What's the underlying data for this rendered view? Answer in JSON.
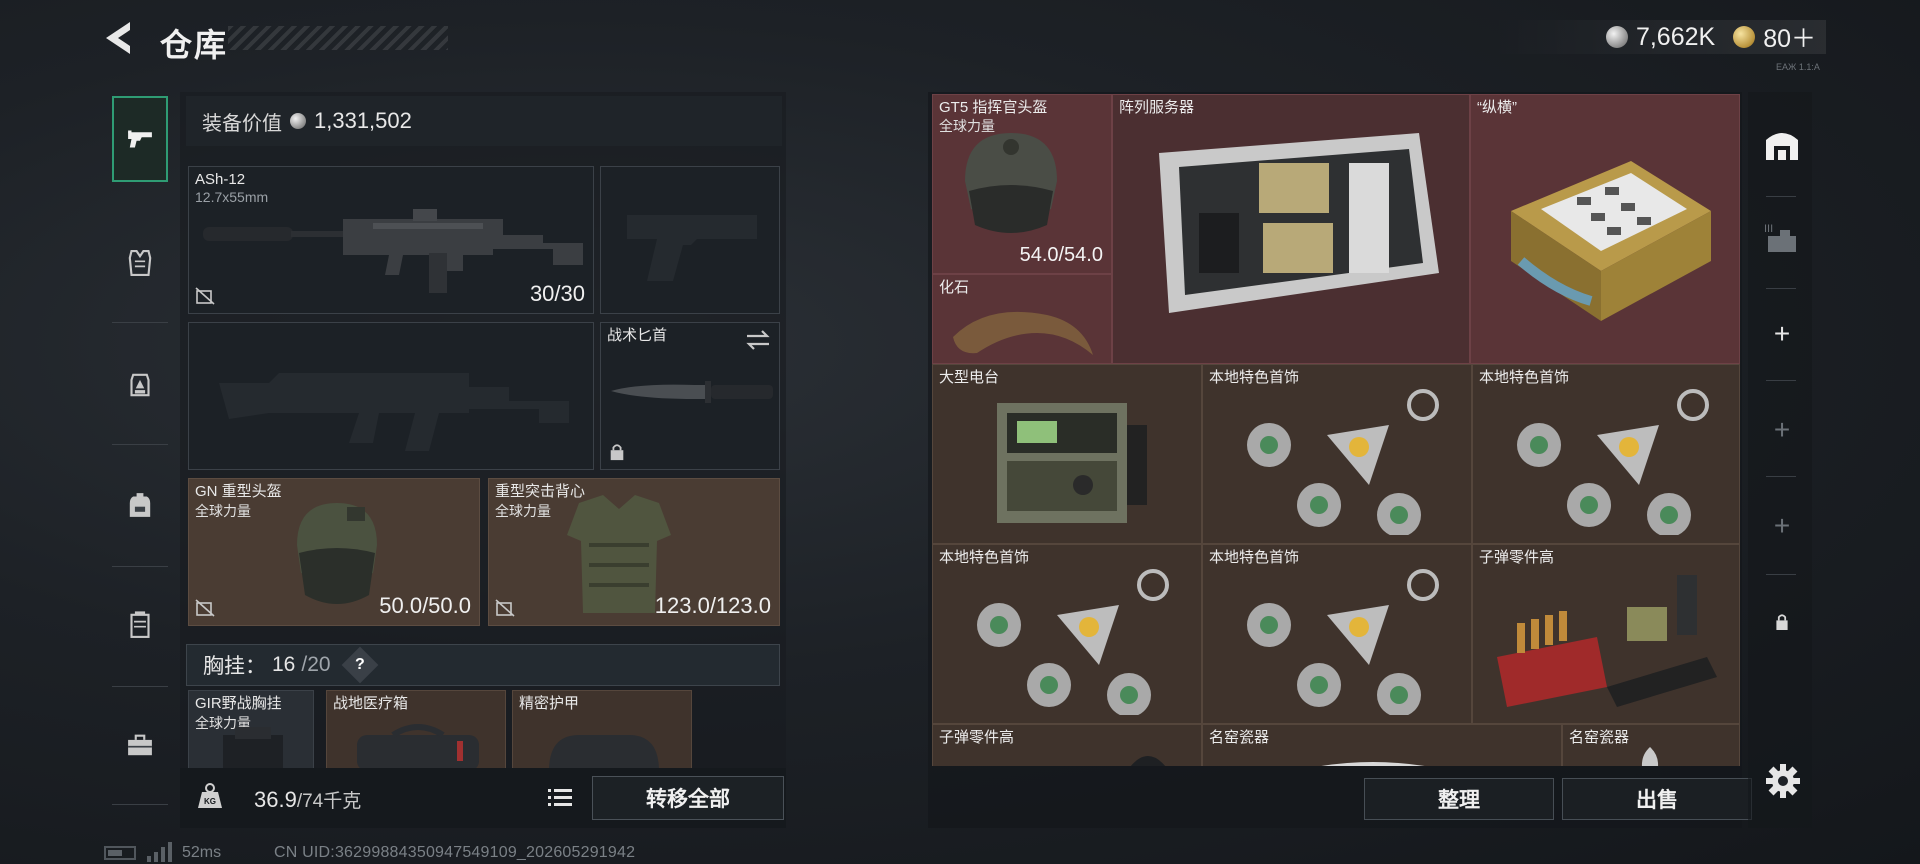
{
  "header": {
    "title": "仓库",
    "currency_silver": "7,662K",
    "currency_gold": "80＋",
    "tiny_text": "ЕАЖ 1.1:А"
  },
  "tabs": [
    {
      "name": "weapon",
      "icon": "pistol-icon",
      "active": true
    },
    {
      "name": "armor-vest",
      "icon": "armor-vest-icon",
      "active": false
    },
    {
      "name": "chest-rig",
      "icon": "chest-rig-icon",
      "active": false
    },
    {
      "name": "backpack",
      "icon": "backpack-icon",
      "active": false
    },
    {
      "name": "container",
      "icon": "container-icon",
      "active": false
    },
    {
      "name": "case",
      "icon": "toolbox-icon",
      "active": false
    }
  ],
  "equipment": {
    "value_label": "装备价值",
    "value": "1,331,502",
    "primary_weapon": {
      "name": "ASh-12",
      "caliber": "12.7x55mm",
      "ammo": "30/30"
    },
    "pistol_slot": {
      "name": ""
    },
    "secondary_weapon_slot": {
      "name": ""
    },
    "knife": {
      "name": "战术匕首"
    },
    "helmet": {
      "name": "GN 重型头盔",
      "faction": "全球力量",
      "durability": "50.0/50.0"
    },
    "armor": {
      "name": "重型突击背心",
      "faction": "全球力量",
      "durability": "123.0/123.0"
    },
    "chest_rig": {
      "label": "胸挂：",
      "used": "16",
      "capacity": "/20",
      "help": "?"
    },
    "rig_items": [
      {
        "name": "GIR野战胸挂",
        "faction": "全球力量"
      },
      {
        "name": "战地医疗箱"
      },
      {
        "name": "精密护甲"
      }
    ],
    "weight": {
      "current": "36.9",
      "max": "/74千克"
    },
    "transfer_all": "转移全部"
  },
  "inventory": {
    "items": [
      {
        "name": "GT5 指挥官头盔",
        "faction": "全球力量",
        "durability": "54.0/54.0"
      },
      {
        "name": "阵列服务器"
      },
      {
        "name": "“纵横”"
      },
      {
        "name": "化石"
      },
      {
        "name": "大型电台"
      },
      {
        "name": "本地特色首饰"
      },
      {
        "name": "本地特色首饰"
      },
      {
        "name": "本地特色首饰"
      },
      {
        "name": "本地特色首饰"
      },
      {
        "name": "子弹零件高"
      },
      {
        "name": "子弹零件高"
      },
      {
        "name": "名窑瓷器"
      },
      {
        "name": "名窑瓷器"
      }
    ],
    "sort_label": "整理",
    "sell_label": "出售"
  },
  "rail": {
    "plus": "+"
  },
  "status": {
    "ping": "52ms",
    "uid": "CN UID:3629988435094754​9109_202605291942"
  },
  "colors": {
    "active_tab_border": "#2f9c74",
    "inventory_bg": "#3f332c",
    "high_value_cell": "#5a3437",
    "equipment_slot_brown": "#4a3c33"
  }
}
